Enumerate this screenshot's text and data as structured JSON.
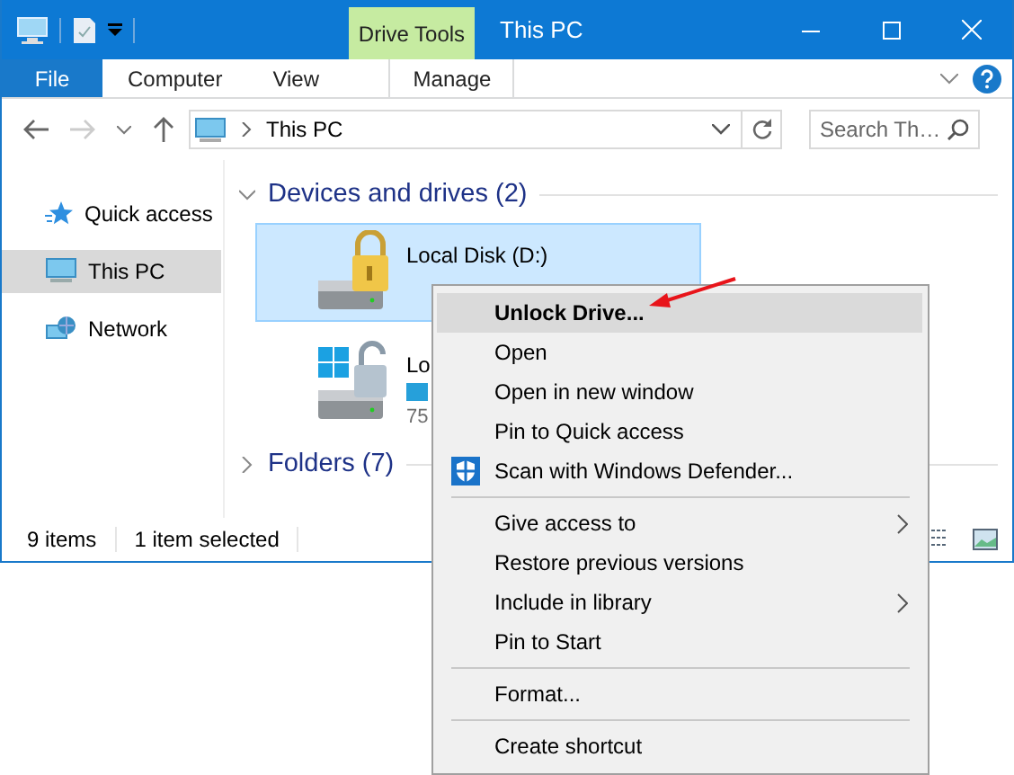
{
  "window": {
    "title": "This PC",
    "contextual_tab": "Drive Tools"
  },
  "ribbon_tabs": [
    {
      "label": "File",
      "kind": "file"
    },
    {
      "label": "Computer",
      "kind": "tab"
    },
    {
      "label": "View",
      "kind": "tab"
    },
    {
      "label": "Manage",
      "kind": "contextual"
    }
  ],
  "address": {
    "path": "This PC"
  },
  "search": {
    "placeholder": "Search Th…"
  },
  "sidebar": {
    "items": [
      {
        "label": "Quick access",
        "kind": "star",
        "selected": false
      },
      {
        "label": "This PC",
        "kind": "pc",
        "selected": true
      },
      {
        "label": "Network",
        "kind": "network",
        "selected": false
      }
    ]
  },
  "sections": [
    {
      "title": "Devices and drives (2)",
      "expanded": true
    },
    {
      "title": "Folders (7)",
      "expanded": false
    }
  ],
  "drives": [
    {
      "name": "Local Disk (D:)",
      "kind": "locked",
      "selected": true
    },
    {
      "name": "Lo",
      "detail": "75",
      "kind": "system",
      "selected": false
    }
  ],
  "status_bar": {
    "item_count": "9 items",
    "selection": "1 item selected"
  },
  "context_menu": [
    {
      "kind": "item",
      "label": "Unlock Drive...",
      "bold": true,
      "selected": true,
      "submenu": false
    },
    {
      "kind": "item",
      "label": "Open",
      "bold": false,
      "selected": false,
      "submenu": false
    },
    {
      "kind": "item",
      "label": "Open in new window",
      "bold": false,
      "selected": false,
      "submenu": false
    },
    {
      "kind": "item",
      "label": "Pin to Quick access",
      "bold": false,
      "selected": false,
      "submenu": false
    },
    {
      "kind": "shield",
      "label": "Scan with Windows Defender...",
      "bold": false,
      "selected": false,
      "submenu": false
    },
    {
      "kind": "separator"
    },
    {
      "kind": "item",
      "label": "Give access to",
      "bold": false,
      "selected": false,
      "submenu": true
    },
    {
      "kind": "item",
      "label": "Restore previous versions",
      "bold": false,
      "selected": false,
      "submenu": false
    },
    {
      "kind": "item",
      "label": "Include in library",
      "bold": false,
      "selected": false,
      "submenu": true
    },
    {
      "kind": "item",
      "label": "Pin to Start",
      "bold": false,
      "selected": false,
      "submenu": false
    },
    {
      "kind": "separator"
    },
    {
      "kind": "item",
      "label": "Format...",
      "bold": false,
      "selected": false,
      "submenu": false
    },
    {
      "kind": "separator"
    },
    {
      "kind": "item",
      "label": "Create shortcut",
      "bold": false,
      "selected": false,
      "submenu": false
    }
  ]
}
